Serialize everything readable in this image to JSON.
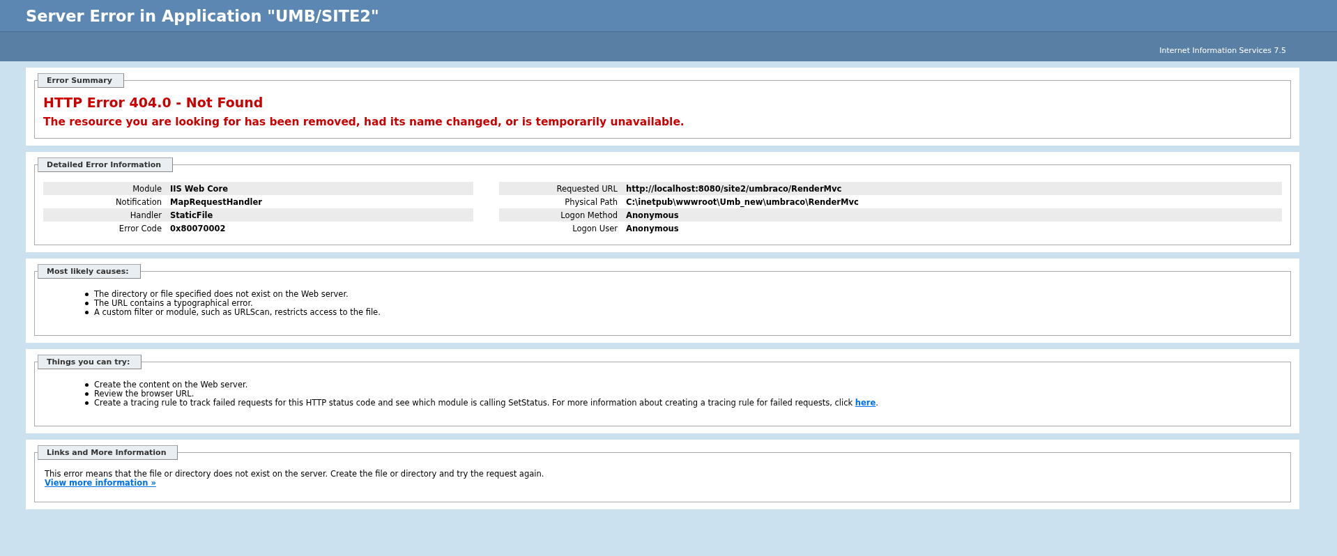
{
  "header": {
    "title": "Server Error in Application \"UMB/SITE2\"",
    "product": "Internet Information Services 7.5"
  },
  "sections": [
    {
      "kind": "summary",
      "legend": "Error Summary",
      "heading": "HTTP Error 404.0 - Not Found",
      "message": "The resource you are looking for has been removed, had its name changed, or is temporarily unavailable."
    },
    {
      "kind": "details",
      "legend": "Detailed Error Information",
      "tables": [
        [
          {
            "label": "Module",
            "value": "IIS Web Core"
          },
          {
            "label": "Notification",
            "value": "MapRequestHandler"
          },
          {
            "label": "Handler",
            "value": "StaticFile"
          },
          {
            "label": "Error Code",
            "value": "0x80070002"
          }
        ],
        [
          {
            "label": "Requested URL",
            "value": "http://localhost:8080/site2/umbraco/RenderMvc"
          },
          {
            "label": "Physical Path",
            "value": "C:\\inetpub\\wwwroot\\Umb_new\\umbraco\\RenderMvc"
          },
          {
            "label": "Logon Method",
            "value": "Anonymous"
          },
          {
            "label": "Logon User",
            "value": "Anonymous"
          }
        ]
      ]
    },
    {
      "kind": "list",
      "legend": "Most likely causes:",
      "items": [
        {
          "text": "The directory or file specified does not exist on the Web server."
        },
        {
          "text": "The URL contains a typographical error."
        },
        {
          "text": "A custom filter or module, such as URLScan, restricts access to the file."
        }
      ]
    },
    {
      "kind": "list",
      "legend": "Things you can try:",
      "items": [
        {
          "text": "Create the content on the Web server."
        },
        {
          "text": "Review the browser URL."
        },
        {
          "text": "Create a tracing rule to track failed requests for this HTTP status code and see which module is calling SetStatus. For more information about creating a tracing rule for failed requests, click ",
          "link": "here",
          "after": "."
        }
      ]
    },
    {
      "kind": "links",
      "legend": "Links and More Information",
      "text": "This error means that the file or directory does not exist on the server. Create the file or directory and try the request again.",
      "link": "View more information »"
    }
  ]
}
